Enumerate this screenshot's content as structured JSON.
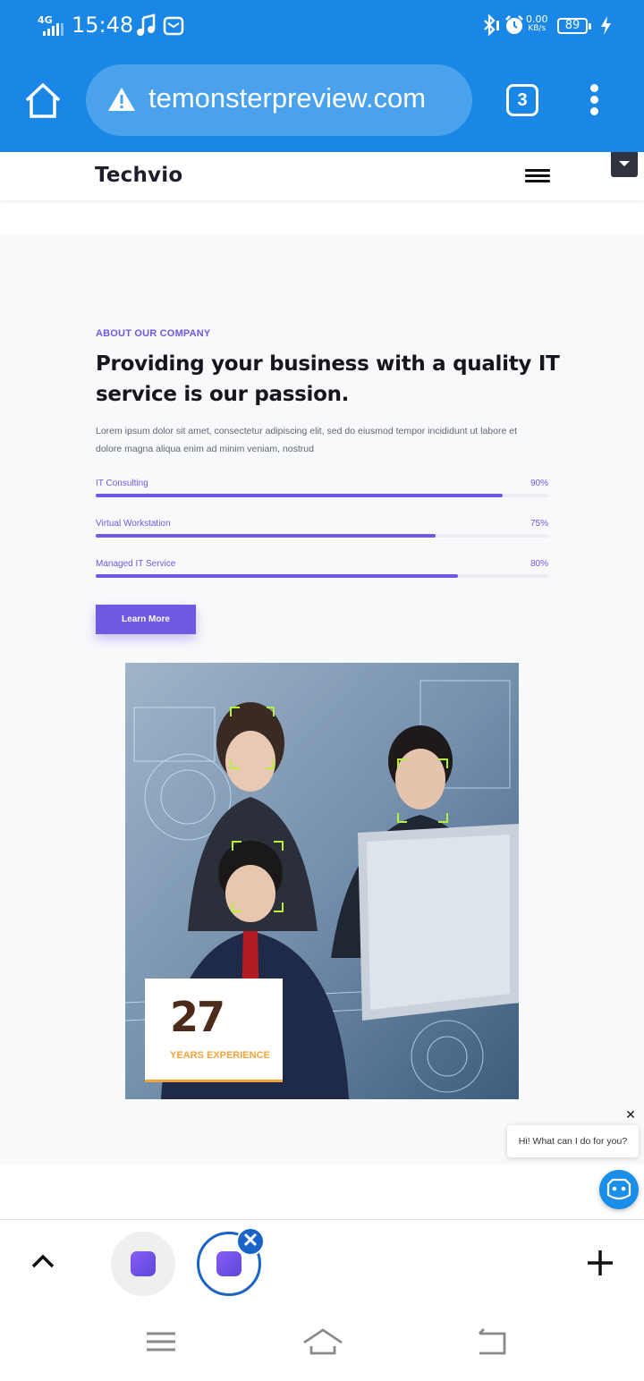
{
  "status_bar": {
    "network": "4G",
    "time": "15:48",
    "speed_value": "0.00",
    "speed_unit": "KB/s",
    "battery": "89"
  },
  "browser": {
    "url": "temonsterpreview.com",
    "tab_count": "3"
  },
  "site": {
    "logo": "Techvio"
  },
  "about": {
    "eyebrow": "ABOUT OUR COMPANY",
    "heading": "Providing your business with a quality IT service is our passion.",
    "lead": "Lorem ipsum dolor sit amet, consectetur adipiscing elit, sed do eiusmod tempor incididunt ut labore et dolore magna aliqua enim ad minim veniam, nostrud",
    "skills": [
      {
        "label": "IT Consulting",
        "percent_text": "90%",
        "value": 90
      },
      {
        "label": "Virtual Workstation",
        "percent_text": "75%",
        "value": 75
      },
      {
        "label": "Managed IT Service",
        "percent_text": "80%",
        "value": 80
      }
    ],
    "button_label": "Learn More",
    "experience_number": "27",
    "experience_label": "YEARS EXPERIENCE"
  },
  "chat": {
    "close_glyph": "✕",
    "message": "Hi! What can I do for you?"
  },
  "tabbar": {
    "close_glyph": "✕"
  },
  "colors": {
    "chrome_blue": "#1a87e6",
    "accent_purple": "#7158e2",
    "experience_orange": "#f2a33b",
    "tab_active_blue": "#1a64c8"
  }
}
